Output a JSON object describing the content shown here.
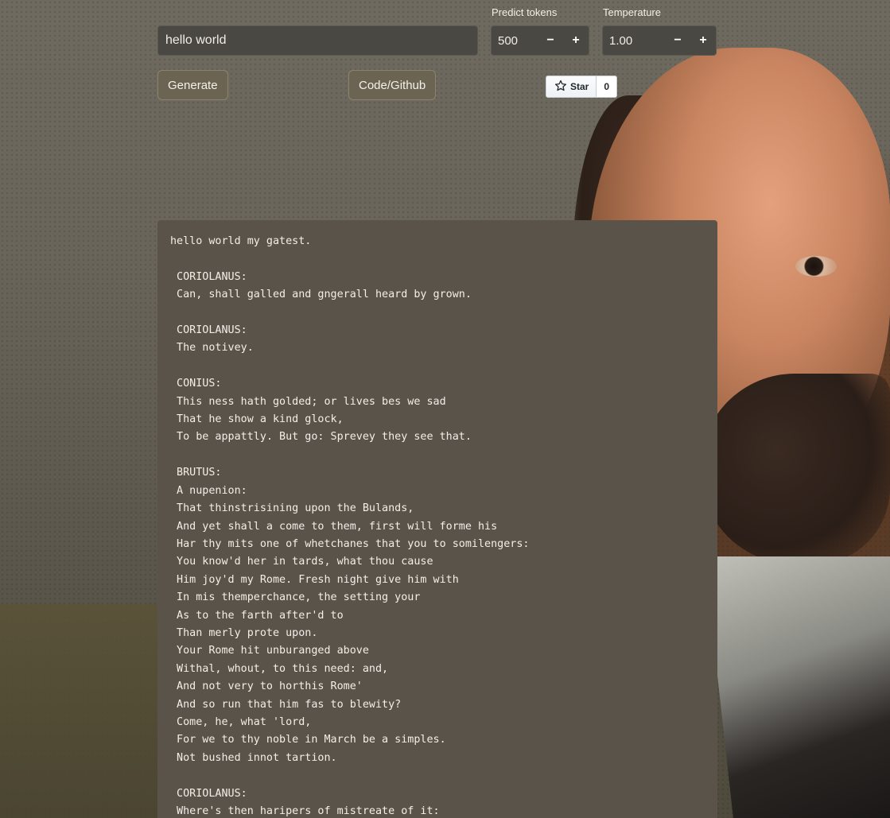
{
  "prompt": {
    "value": "hello world"
  },
  "predict_tokens": {
    "label": "Predict tokens",
    "value": "500",
    "decrement": "−",
    "increment": "+"
  },
  "temperature": {
    "label": "Temperature",
    "value": "1.00",
    "decrement": "−",
    "increment": "+"
  },
  "buttons": {
    "generate": "Generate",
    "code": "Code/Github"
  },
  "github_star": {
    "label": "Star",
    "count": "0"
  },
  "output": {
    "text": "hello world my gatest.\n\n CORIOLANUS:\n Can, shall galled and gngerall heard by grown.\n\n CORIOLANUS:\n The notivey.\n\n CONIUS:\n This ness hath golded; or lives bes we sad\n That he show a kind glock,\n To be appattly. But go: Sprevey they see that.\n\n BRUTUS:\n A nupenion:\n That thinstrisining upon the Bulands,\n And yet shall a come to them, first will forme his\n Har thy mits one of whetchanes that you to somilengers:\n You know'd her in tards, what thou cause\n Him joy'd my Rome. Fresh night give him with\n In mis themperchance, the setting your\n As to the farth after'd to\n Than merly prote upon.\n Your Rome hit unburanged above\n Withal, whout, to this need: and,\n And not very to horthis Rome'\n And so run that him fas to blewity?\n Come, he, what 'lord,\n For we to thy noble in March be a simples.\n Not bushed innot tartion.\n\n CORIOLANUS:\n Where's then haripers of mistreate of it:"
  }
}
